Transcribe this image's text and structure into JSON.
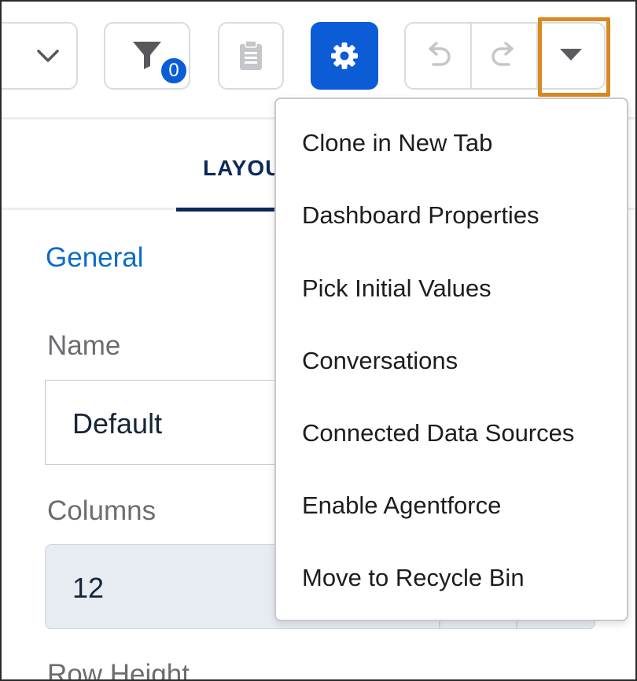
{
  "toolbar": {
    "filter_count": "0",
    "icons": [
      "chevron-down-icon",
      "filter-icon",
      "clipboard-icon",
      "gear-icon",
      "undo-icon",
      "redo-icon",
      "caret-down-icon"
    ],
    "colors": {
      "primary": "#0b5cd5",
      "highlight": "#d98a1f"
    }
  },
  "tabs": {
    "layout_label": "LAYOU"
  },
  "form": {
    "section_title": "General",
    "name_label": "Name",
    "name_value": "Default",
    "columns_label": "Columns",
    "columns_value": "12",
    "row_height_label": "Row Height"
  },
  "menu": {
    "items": [
      {
        "label": "Clone in New Tab"
      },
      {
        "label": "Dashboard Properties"
      },
      {
        "label": "Pick Initial Values"
      },
      {
        "label": "Conversations"
      },
      {
        "label": "Connected Data Sources"
      },
      {
        "label": "Enable Agentforce"
      },
      {
        "label": "Move to Recycle Bin"
      }
    ]
  }
}
